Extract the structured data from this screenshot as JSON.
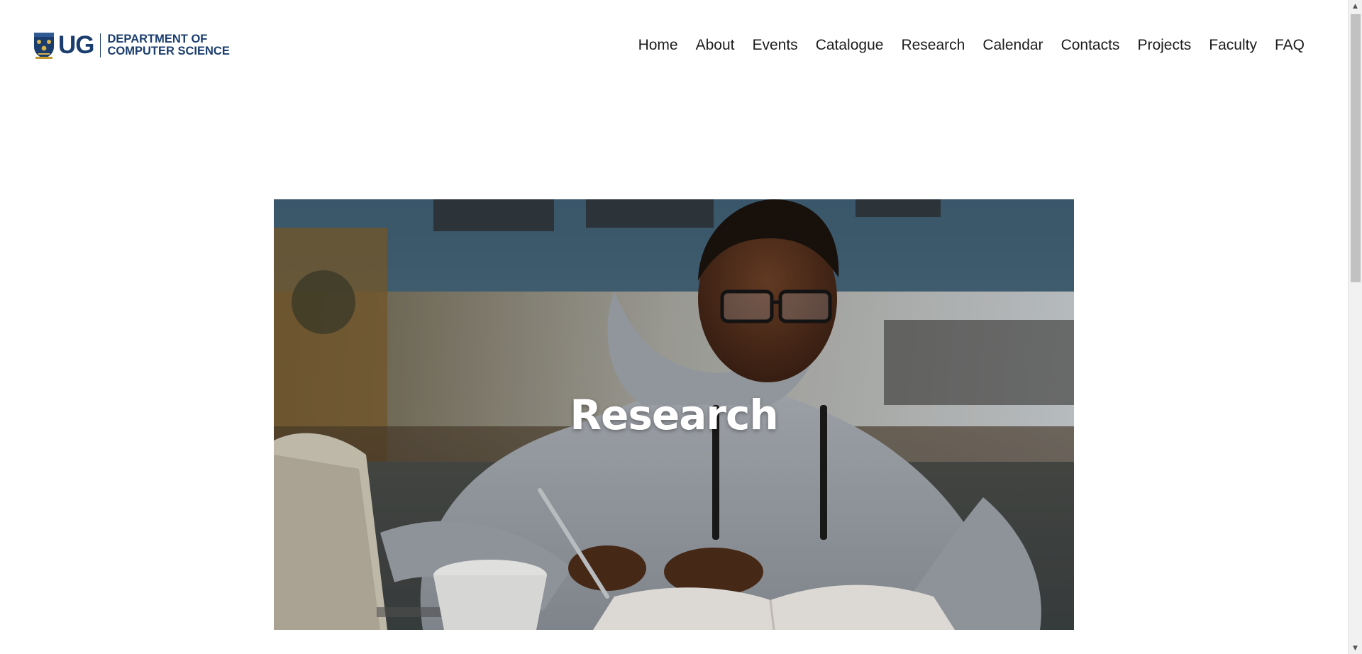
{
  "header": {
    "logo_abbr": "UG",
    "dept_line1": "DEPARTMENT OF",
    "dept_line2": "COMPUTER SCIENCE"
  },
  "nav": {
    "items": [
      "Home",
      "About",
      "Events",
      "Catalogue",
      "Research",
      "Calendar",
      "Contacts",
      "Projects",
      "Faculty",
      "FAQ"
    ]
  },
  "hero": {
    "title": "Research",
    "image_alt": "student-writing-notes-icon"
  },
  "colors": {
    "brand_navy": "#1a3d6e",
    "nav_text": "#1c1c1c",
    "hero_text": "#ffffff"
  },
  "scrollbar": {
    "up_arrow": "▲",
    "down_arrow": "▼"
  }
}
